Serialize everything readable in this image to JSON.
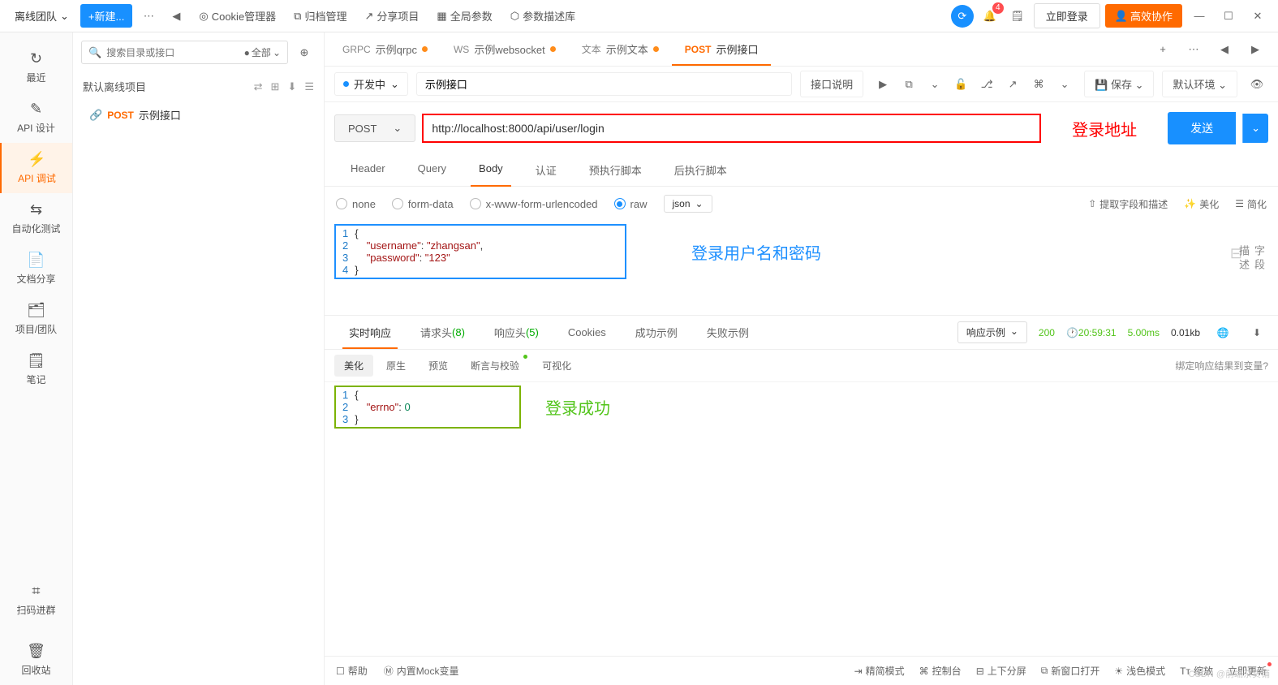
{
  "topbar": {
    "team": "离线团队",
    "new_btn": "+新建...",
    "links": {
      "cookie": "Cookie管理器",
      "archive": "归档管理",
      "share": "分享项目",
      "global": "全局参数",
      "param_lib": "参数描述库"
    },
    "login": "立即登录",
    "collab": "高效协作",
    "notif_count": "4"
  },
  "rail": {
    "recent": "最近",
    "design": "API 设计",
    "debug": "API 调试",
    "autotest": "自动化测试",
    "docs": "文档分享",
    "project": "项目/团队",
    "notes": "笔记",
    "scan": "扫码进群",
    "trash": "回收站"
  },
  "tree": {
    "search_ph": "搜索目录或接口",
    "filter": "全部",
    "project": "默认离线项目",
    "item_method": "POST",
    "item_name": "示例接口"
  },
  "tabs": [
    {
      "prefix": "GRPC",
      "name": "示例qrpc"
    },
    {
      "prefix": "WS",
      "name": "示例websocket"
    },
    {
      "prefix": "文本",
      "name": "示例文本"
    },
    {
      "prefix": "POST",
      "name": "示例接口"
    }
  ],
  "api": {
    "status": "开发中",
    "name": "示例接口",
    "desc_btn": "接口说明",
    "save": "保存",
    "env": "默认环境",
    "method": "POST",
    "url": "http://localhost:8000/api/user/login",
    "send": "发送",
    "annotation_url": "登录地址"
  },
  "param_tabs": [
    "Header",
    "Query",
    "Body",
    "认证",
    "预执行脚本",
    "后执行脚本"
  ],
  "body": {
    "radios": [
      "none",
      "form-data",
      "x-www-form-urlencoded",
      "raw"
    ],
    "type": "json",
    "actions": {
      "extract": "提取字段和描述",
      "beautify": "美化",
      "simplify": "简化"
    },
    "code": {
      "lines": [
        "1",
        "2",
        "3",
        "4"
      ],
      "l1": "{",
      "l2_key": "\"username\"",
      "l2_val": "\"zhangsan\"",
      "l3_key": "\"password\"",
      "l3_val": "\"123\"",
      "l4": "}"
    },
    "annotation": "登录用户名和密码",
    "side": "字段描述"
  },
  "response": {
    "tabs": {
      "realtime": "实时响应",
      "req_headers": "请求头",
      "req_count": "(8)",
      "resp_headers": "响应头",
      "resp_count": "(5)",
      "cookies": "Cookies",
      "success_ex": "成功示例",
      "fail_ex": "失败示例"
    },
    "example_sel": "响应示例",
    "status": "200",
    "time_label": "20:59:31",
    "duration": "5.00ms",
    "size": "0.01kb",
    "sub": {
      "beautify": "美化",
      "raw": "原生",
      "preview": "预览",
      "assert": "断言与校验",
      "visual": "可视化"
    },
    "bind": "绑定响应结果到变量?",
    "code": {
      "lines": [
        "1",
        "2",
        "3"
      ],
      "l1": "{",
      "l2_key": "\"errno\"",
      "l2_val": "0",
      "l3": "}"
    },
    "annotation": "登录成功"
  },
  "footer": {
    "help": "帮助",
    "mock": "内置Mock变量",
    "compact": "精简模式",
    "console": "控制台",
    "split": "上下分屏",
    "newwin": "新窗口打开",
    "theme": "浅色模式",
    "zoom": "缩放",
    "update": "立即更新"
  },
  "watermark": "CSDN @前端杂货铺"
}
